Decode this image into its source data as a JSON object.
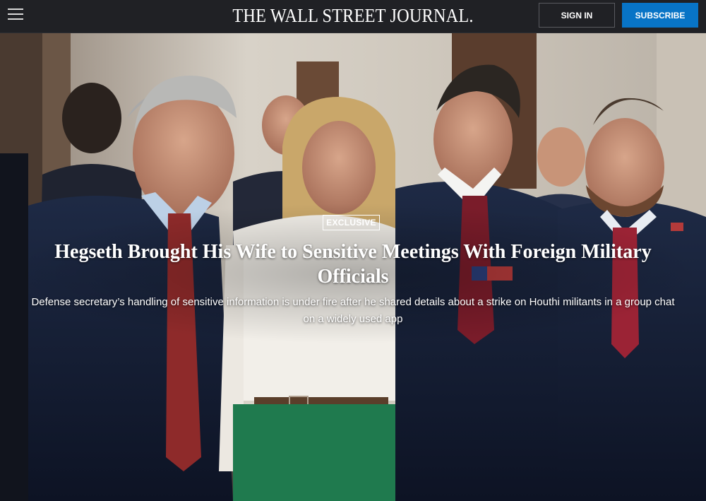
{
  "header": {
    "masthead": "THE WALL STREET JOURNAL.",
    "signin_label": "SIGN IN",
    "subscribe_label": "SUBSCRIBE",
    "menu_icon": "hamburger-menu-icon"
  },
  "hero": {
    "badge": "EXCLUSIVE",
    "headline": "Hegseth Brought His Wife to Sensitive Meetings With Foreign Military Officials",
    "dek": "Defense secretary’s handling of sensitive information is under fire after he shared details about a strike on Houthi militants in a group chat on a widely used app"
  },
  "colors": {
    "topbar": "#202125",
    "subscribe": "#0874c6",
    "text": "#ffffff"
  }
}
